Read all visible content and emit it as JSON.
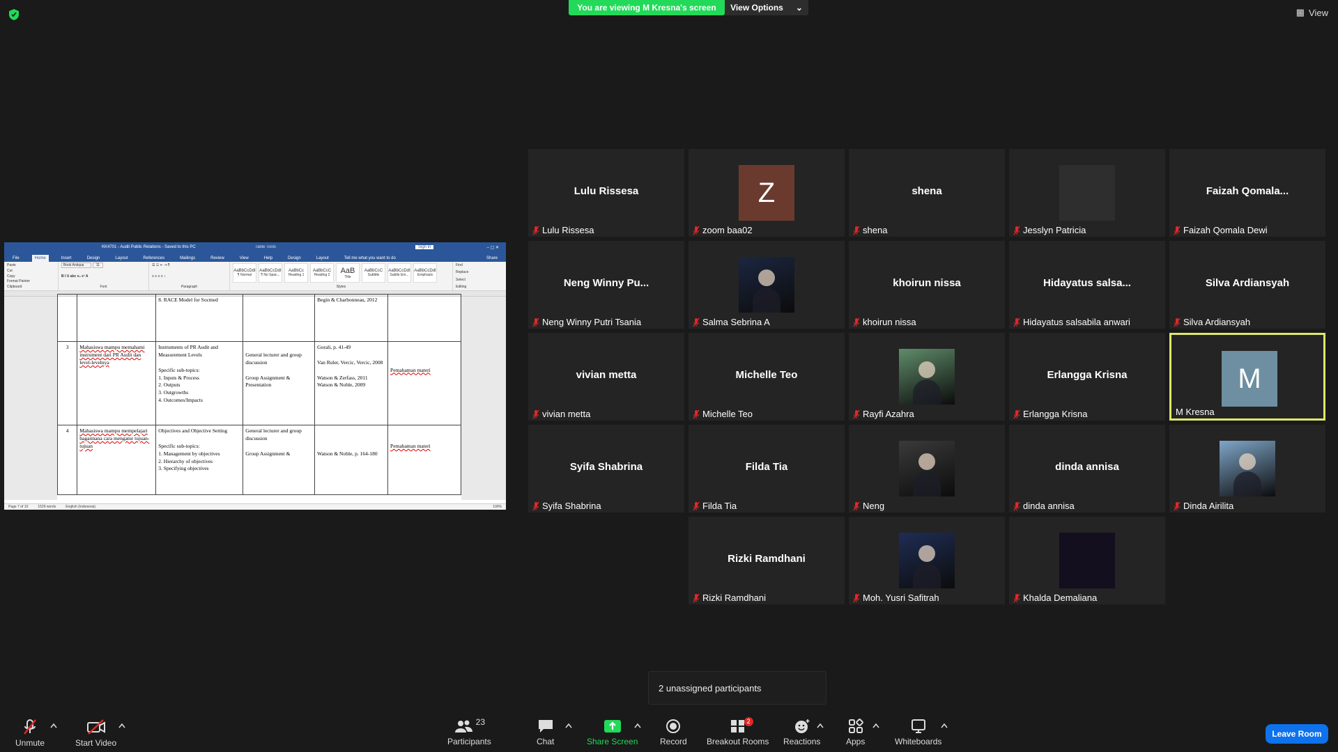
{
  "banner": {
    "viewing": "You are viewing M Kresna's screen",
    "view_options": "View Options",
    "view": "View"
  },
  "word": {
    "title": "KK4701 - Audit Public Relations - Saved to this PC",
    "table_tools": "Table Tools",
    "sign_in": "Sign in",
    "share": "Share",
    "tell_me": "Tell me what you want to do",
    "tabs": [
      "File",
      "Home",
      "Insert",
      "Design",
      "Layout",
      "References",
      "Mailings",
      "Review",
      "View",
      "Help",
      "Design",
      "Layout"
    ],
    "ribbon": {
      "paste": "Paste",
      "cut": "Cut",
      "copy": "Copy",
      "format_painter": "Format Painter",
      "clipboard": "Clipboard",
      "font_name": "Book Antiqua",
      "font_size": "11",
      "font": "Font",
      "paragraph": "Paragraph",
      "styles_label": "Styles",
      "editing": "Editing",
      "find": "Find",
      "replace": "Replace",
      "select": "Select",
      "styles": [
        {
          "preview": "AaBbCcDdI",
          "name": "¶ Normal"
        },
        {
          "preview": "AaBbCcDdI",
          "name": "¶ No Spac..."
        },
        {
          "preview": "AaBbCc",
          "name": "Heading 1"
        },
        {
          "preview": "AaBbCcC",
          "name": "Heading 2"
        },
        {
          "preview": "AaB",
          "name": "Title"
        },
        {
          "preview": "AaBbCcC",
          "name": "Subtitle"
        },
        {
          "preview": "AaBbCcDdI",
          "name": "Subtle Em..."
        },
        {
          "preview": "AaBbCcDdI",
          "name": "Emphasis"
        }
      ]
    },
    "rows": [
      {
        "no": "",
        "objective": "",
        "topic": "8. RACE Model for Socmed",
        "method": "",
        "ref": "Begin & Charbonneau, 2012",
        "assess": ""
      },
      {
        "no": "3",
        "objective": "Mahasiswa mampu memahami instrument dari PR Audit dan level-levelnya",
        "topic": "Instruments of PR Audit and Measurement Levels\n\nSpecific sub-topics:\n1. Inputs & Process\n2. Outputs\n3. Outgrowths\n4. Outcomes/Impacts",
        "method": "\nGeneral lecturer and group discussion\n\nGroup Assignment & Presentation",
        "ref": "Gorali, p. 41-49\n\nVan Ruler, Vercic, Vercic, 2008\n\nWatson & Zerfass, 2011\nWatson & Noble, 2009",
        "assess": "\n\n\nPemahaman materi"
      },
      {
        "no": "4",
        "objective": "Mahasiswa mampu mempelajari bagaimana cara mengatur tujuan-tujuan",
        "topic": "Objectives and Objective Setting\n\nSpecific sub-topics:\n1. Management by objectives\n2. Hierarchy of objectives\n3. Specifying objectives",
        "method": "General lecturer and group discussion\n\nGroup Assignment &",
        "ref": "\n\n\nWatson & Noble, p. 164-180",
        "assess": "\n\nPemahaman materi"
      }
    ],
    "status": {
      "page": "Page 7 of 10",
      "words": "1529 words",
      "language": "English (Indonesia)",
      "zoom": "100%"
    }
  },
  "participants": [
    {
      "display": "Lulu Rissesa",
      "label": "Lulu Rissesa",
      "kind": "name"
    },
    {
      "display": "Z",
      "label": "zoom baa02",
      "kind": "avatar",
      "color": "#6b3a2e"
    },
    {
      "display": "shena",
      "label": "shena",
      "kind": "name"
    },
    {
      "display": "",
      "label": "Jesslyn Patricia",
      "kind": "avatar",
      "color": "#2e2e2e"
    },
    {
      "display": "Faizah Qomala...",
      "label": "Faizah Qomala Dewi",
      "kind": "name"
    },
    {
      "display": "Neng Winny Pu...",
      "label": "Neng Winny Putri Tsania",
      "kind": "name"
    },
    {
      "display": "",
      "label": "Salma Sebrina A",
      "kind": "photo",
      "color": "#1b2640"
    },
    {
      "display": "khoirun nissa",
      "label": "khoirun nissa",
      "kind": "name"
    },
    {
      "display": "Hidayatus salsa...",
      "label": "Hidayatus salsabila anwari",
      "kind": "name"
    },
    {
      "display": "Silva Ardiansyah",
      "label": "Silva Ardiansyah",
      "kind": "name"
    },
    {
      "display": "vivian metta",
      "label": "vivian metta",
      "kind": "name"
    },
    {
      "display": "Michelle Teo",
      "label": "Michelle Teo",
      "kind": "name"
    },
    {
      "display": "",
      "label": "Rayfi Azahra",
      "kind": "photo",
      "color": "#5f8c6a"
    },
    {
      "display": "Erlangga Krisna",
      "label": "Erlangga Krisna",
      "kind": "name"
    },
    {
      "display": "M",
      "label": "M Kresna",
      "kind": "avatar",
      "color": "#6d8fa1",
      "active": true
    },
    {
      "display": "Syifa Shabrina",
      "label": "Syifa Shabrina",
      "kind": "name"
    },
    {
      "display": "Filda Tia",
      "label": "Filda Tia",
      "kind": "name"
    },
    {
      "display": "",
      "label": "Neng",
      "kind": "photo",
      "color": "#3a3a3a"
    },
    {
      "display": "dinda annisa",
      "label": "dinda annisa",
      "kind": "name"
    },
    {
      "display": "",
      "label": "Dinda Airilita",
      "kind": "photo",
      "color": "#7fa6c9"
    },
    {
      "display": "Rizki Ramdhani",
      "label": "Rizki Ramdhani",
      "kind": "name"
    },
    {
      "display": "",
      "label": "Moh. Yusri Safitrah",
      "kind": "photo",
      "color": "#1f2d55"
    },
    {
      "display": "",
      "label": "Khalda Demaliana",
      "kind": "avatar",
      "color": "#130f1f"
    }
  ],
  "popup": {
    "text": "2 unassigned participants"
  },
  "toolbar": {
    "unmute": "Unmute",
    "start_video": "Start Video",
    "participants": "Participants",
    "participants_count": "23",
    "chat": "Chat",
    "share_screen": "Share Screen",
    "record": "Record",
    "breakout_rooms": "Breakout Rooms",
    "breakout_badge": "2",
    "reactions": "Reactions",
    "apps": "Apps",
    "whiteboards": "Whiteboards",
    "leave_room": "Leave Room"
  },
  "colors": {
    "green": "#23d959",
    "leave": "#0e72ed",
    "active_border": "#dfe86b",
    "muted": "#e02828"
  }
}
